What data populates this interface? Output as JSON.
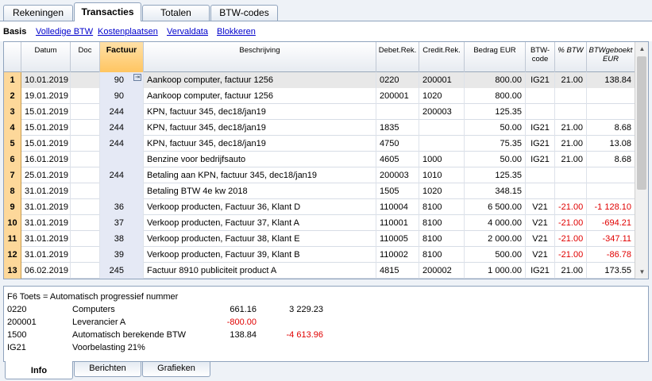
{
  "top_tabs": [
    "Rekeningen",
    "Transacties",
    "Totalen",
    "BTW-codes"
  ],
  "sub_links": {
    "current": "Basis",
    "links": [
      "Volledige BTW",
      "Kostenplaatsen",
      "Vervaldata",
      "Blokkeren"
    ]
  },
  "columns": [
    "Datum",
    "Doc",
    "Factuur",
    "Beschrijving",
    "Debet.Rek.",
    "Credit.Rek.",
    "Bedrag EUR",
    "BTW-\ncode",
    "% BTW",
    "BTWgeboekt\nEUR"
  ],
  "rows": [
    {
      "n": "1",
      "date": "10.01.2019",
      "doc": "",
      "fact": "90",
      "desc": "Aankoop computer, factuur 1256",
      "deb": "0220",
      "cred": "200001",
      "amt": "800.00",
      "code": "IG21",
      "pct": "21.00",
      "btw": "138.84"
    },
    {
      "n": "2",
      "date": "19.01.2019",
      "doc": "",
      "fact": "90",
      "desc": "Aankoop computer, factuur 1256",
      "deb": "200001",
      "cred": "1020",
      "amt": "800.00",
      "code": "",
      "pct": "",
      "btw": ""
    },
    {
      "n": "3",
      "date": "15.01.2019",
      "doc": "",
      "fact": "244",
      "desc": "KPN, factuur 345, dec18/jan19",
      "deb": "",
      "cred": "200003",
      "amt": "125.35",
      "code": "",
      "pct": "",
      "btw": ""
    },
    {
      "n": "4",
      "date": "15.01.2019",
      "doc": "",
      "fact": "244",
      "desc": "KPN, factuur 345, dec18/jan19",
      "deb": "1835",
      "cred": "",
      "amt": "50.00",
      "code": "IG21",
      "pct": "21.00",
      "btw": "8.68"
    },
    {
      "n": "5",
      "date": "15.01.2019",
      "doc": "",
      "fact": "244",
      "desc": "KPN, factuur 345, dec18/jan19",
      "deb": "4750",
      "cred": "",
      "amt": "75.35",
      "code": "IG21",
      "pct": "21.00",
      "btw": "13.08"
    },
    {
      "n": "6",
      "date": "16.01.2019",
      "doc": "",
      "fact": "",
      "desc": "Benzine voor bedrijfsauto",
      "deb": "4605",
      "cred": "1000",
      "amt": "50.00",
      "code": "IG21",
      "pct": "21.00",
      "btw": "8.68"
    },
    {
      "n": "7",
      "date": "25.01.2019",
      "doc": "",
      "fact": "244",
      "desc": "Betaling aan KPN, factuur 345, dec18/jan19",
      "deb": "200003",
      "cred": "1010",
      "amt": "125.35",
      "code": "",
      "pct": "",
      "btw": ""
    },
    {
      "n": "8",
      "date": "31.01.2019",
      "doc": "",
      "fact": "",
      "desc": "Betaling BTW 4e kw 2018",
      "deb": "1505",
      "cred": "1020",
      "amt": "348.15",
      "code": "",
      "pct": "",
      "btw": ""
    },
    {
      "n": "9",
      "date": "31.01.2019",
      "doc": "",
      "fact": "36",
      "desc": "Verkoop producten, Factuur 36, Klant D",
      "deb": "110004",
      "cred": "8100",
      "amt": "6 500.00",
      "code": "V21",
      "pct": "-21.00",
      "btw": "-1 128.10"
    },
    {
      "n": "10",
      "date": "31.01.2019",
      "doc": "",
      "fact": "37",
      "desc": "Verkoop producten, Factuur 37, Klant A",
      "deb": "110001",
      "cred": "8100",
      "amt": "4 000.00",
      "code": "V21",
      "pct": "-21.00",
      "btw": "-694.21"
    },
    {
      "n": "11",
      "date": "31.01.2019",
      "doc": "",
      "fact": "38",
      "desc": "Verkoop producten, Factuur 38, Klant E",
      "deb": "110005",
      "cred": "8100",
      "amt": "2 000.00",
      "code": "V21",
      "pct": "-21.00",
      "btw": "-347.11"
    },
    {
      "n": "12",
      "date": "31.01.2019",
      "doc": "",
      "fact": "39",
      "desc": "Verkoop producten, Factuur 39, Klant B",
      "deb": "110002",
      "cred": "8100",
      "amt": "500.00",
      "code": "V21",
      "pct": "-21.00",
      "btw": "-86.78"
    },
    {
      "n": "13",
      "date": "06.02.2019",
      "doc": "",
      "fact": "245",
      "desc": "Factuur 8910 publiciteit product A",
      "deb": "4815",
      "cred": "200002",
      "amt": "1 000.00",
      "code": "IG21",
      "pct": "21.00",
      "btw": "173.55"
    }
  ],
  "info": {
    "title": "F6 Toets = Automatisch progressief nummer",
    "lines": [
      {
        "code": "0220",
        "label": "Computers",
        "v1": "661.16",
        "v2": "3 229.23"
      },
      {
        "code": "200001",
        "label": "Leverancier A",
        "v1": "-800.00",
        "v2": ""
      },
      {
        "code": "1500",
        "label": "Automatisch berekende BTW",
        "v1": "138.84",
        "v2": "-4 613.96"
      },
      {
        "code": "IG21",
        "label": "Voorbelasting 21%",
        "v1": "",
        "v2": ""
      }
    ]
  },
  "bottom_tabs": [
    "Info",
    "Berichten",
    "Grafieken"
  ],
  "colors": {
    "negative": "#e00000",
    "row_number_bg": "#fdd89a",
    "selected_header": "#ffc561"
  }
}
